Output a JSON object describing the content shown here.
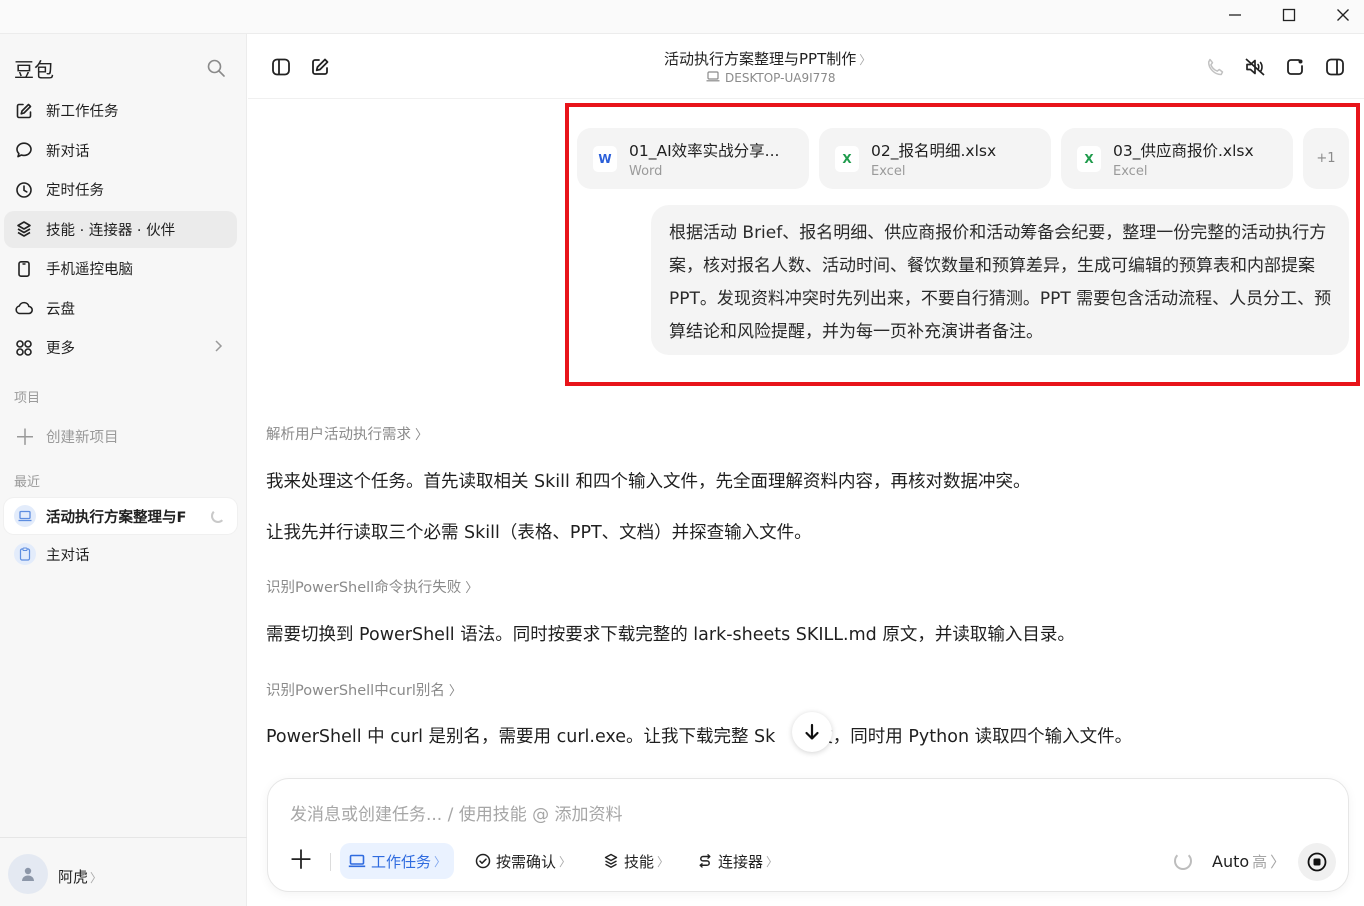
{
  "titlebar": {
    "minimize_icon": "minimize-icon",
    "maximize_icon": "maximize-icon",
    "close_icon": "close-icon"
  },
  "sidebar": {
    "brand": "豆包",
    "nav": [
      {
        "label": "新工作任务",
        "icon": "edit-icon"
      },
      {
        "label": "新对话",
        "icon": "chat-bubble-icon"
      },
      {
        "label": "定时任务",
        "icon": "clock-icon"
      },
      {
        "label": "技能 · 连接器 · 伙伴",
        "icon": "layers-icon"
      },
      {
        "label": "手机遥控电脑",
        "icon": "phone-icon"
      },
      {
        "label": "云盘",
        "icon": "cloud-icon"
      },
      {
        "label": "更多",
        "icon": "grid-icon"
      }
    ],
    "projects_label": "项目",
    "new_project_label": "创建新项目",
    "recent_label": "最近",
    "recent": [
      {
        "label": "活动执行方案整理与F"
      },
      {
        "label": "主对话"
      }
    ],
    "user": {
      "name": "阿虎",
      "chevron": "〉"
    }
  },
  "header": {
    "title": "活动执行方案整理与PPT制作",
    "chevron": "〉",
    "device": "DESKTOP-UA9I778"
  },
  "attachments": [
    {
      "name": "01_AI效率实战分享...",
      "type": "Word",
      "badge": "W",
      "color": "#2b5fd9"
    },
    {
      "name": "02_报名明细.xlsx",
      "type": "Excel",
      "badge": "X",
      "color": "#1f9b4c"
    },
    {
      "name": "03_供应商报价.xlsx",
      "type": "Excel",
      "badge": "X",
      "color": "#1f9b4c"
    }
  ],
  "attachments_more": "+1",
  "user_message": "根据活动 Brief、报名明细、供应商报价和活动筹备会纪要，整理一份完整的活动执行方案，核对报名人数、活动时间、餐饮数量和预算差异，生成可编辑的预算表和内部提案 PPT。发现资料冲突时先列出来，不要自行猜测。PPT 需要包含活动流程、人员分工、预算结论和风险提醒，并为每一页补充演讲者备注。",
  "conversation": {
    "step1": "解析用户活动执行需求",
    "msg1": "我来处理这个任务。首先读取相关 Skill 和四个输入文件，先全面理解资料内容，再核对数据冲突。",
    "msg2": "让我先并行读取三个必需 Skill（表格、PPT、文档）并探查输入文件。",
    "step2": "识别PowerShell命令执行失败",
    "msg3": "需要切换到 PowerShell 语法。同时按要求下载完整的 lark-sheets SKILL.md 原文，并读取输入目录。",
    "step3": "识别PowerShell中curl别名",
    "msg4a": "PowerShell 中 curl 是别名，需要用 curl.exe。让我下载完整 Sk",
    "msg4b": "文，同时用 Python 读取四个输入文件。",
    "step_chevron": "〉"
  },
  "composer": {
    "placeholder": "发消息或创建任务... / 使用技能 @ 添加资料",
    "chips": [
      {
        "label": "工作任务"
      },
      {
        "label": "按需确认"
      },
      {
        "label": "技能"
      },
      {
        "label": "连接器"
      }
    ],
    "chip_chevron": "〉",
    "model": "Auto",
    "model_level": "高",
    "model_chevron": "〉"
  }
}
